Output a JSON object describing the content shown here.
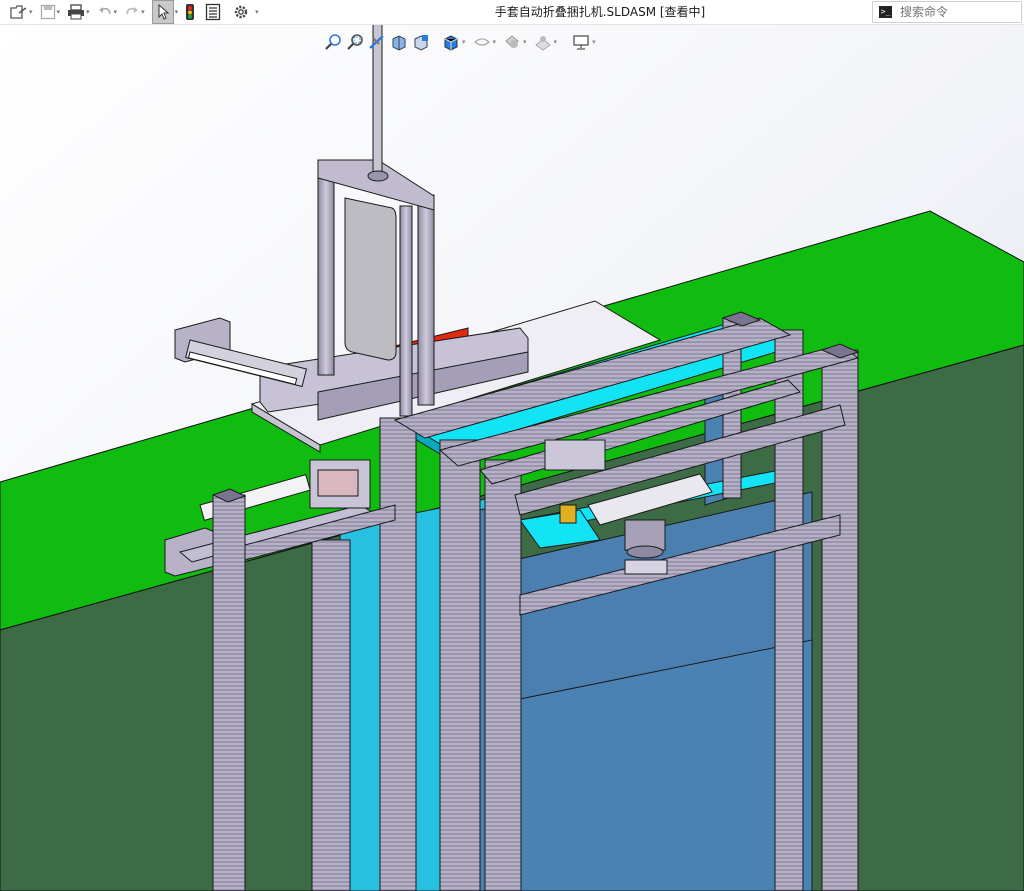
{
  "titlebar": {
    "document_title": "手套自动折叠捆扎机.SLDASM [查看中]",
    "search_placeholder": "搜索命令",
    "dropdown_glyph": "▾"
  },
  "colors": {
    "ground_top": "#0fbc0f",
    "ground_front": "#3d6b46",
    "cyan_part": "#12e3f5",
    "blue_part": "#4a82b4",
    "frame_purple": "#b3aec2",
    "red_part": "#e02a10",
    "sky_gradient_top": "#ffffff",
    "sky_gradient_bottom": "#d7dbe8"
  },
  "toolbar": [
    {
      "name": "open-icon",
      "has_dropdown": true
    },
    {
      "name": "save-icon",
      "has_dropdown": true
    },
    {
      "name": "print-icon",
      "has_dropdown": true
    },
    {
      "name": "undo-icon",
      "has_dropdown": true
    },
    {
      "name": "redo-icon",
      "has_dropdown": true
    },
    {
      "name": "select-pointer-icon",
      "has_dropdown": true,
      "active": true
    },
    {
      "name": "rebuild-traffic-light-icon",
      "has_dropdown": false
    },
    {
      "name": "file-properties-icon",
      "has_dropdown": false
    },
    {
      "name": "options-gear-icon",
      "has_dropdown": true
    }
  ],
  "heads_up_toolbar": [
    {
      "name": "zoom-to-fit-icon"
    },
    {
      "name": "zoom-to-area-icon"
    },
    {
      "name": "previous-view-icon"
    },
    {
      "name": "section-view-icon"
    },
    {
      "name": "dynamic-annotation-view-icon"
    },
    {
      "name": "view-orientation-icon",
      "has_dropdown": true
    },
    {
      "name": "display-style-icon",
      "has_dropdown": true
    },
    {
      "name": "hide-show-items-icon",
      "has_dropdown": true
    },
    {
      "name": "edit-appearance-icon",
      "has_dropdown": true
    },
    {
      "name": "apply-scene-icon",
      "has_dropdown": true
    },
    {
      "name": "view-settings-icon",
      "has_dropdown": true
    }
  ]
}
